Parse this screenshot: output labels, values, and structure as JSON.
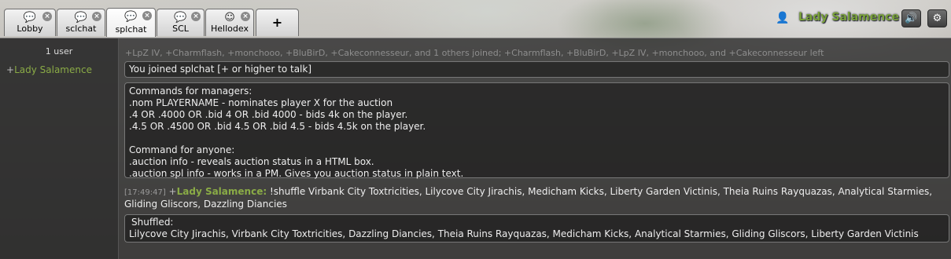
{
  "tabs": [
    {
      "label": "Lobby",
      "icon": "chat-bubble-icon",
      "glyph": "💬",
      "active": false,
      "closable": true
    },
    {
      "label": "sclchat",
      "icon": "chat-bubble-icon",
      "glyph": "💬",
      "active": false,
      "closable": true
    },
    {
      "label": "splchat",
      "icon": "chat-bubble-icon",
      "glyph": "💬",
      "active": true,
      "closable": true
    },
    {
      "label": "SCL",
      "icon": "chat-bubble-icon",
      "glyph": "💬",
      "active": false,
      "closable": true
    },
    {
      "label": "Hellodex",
      "icon": "smiley-icon",
      "glyph": "☺",
      "active": false,
      "closable": true
    }
  ],
  "add_tab": {
    "label": "+"
  },
  "close_glyph": "×",
  "header": {
    "username": "Lady Salamence",
    "user_icon": "person-icon",
    "user_glyph": "👤",
    "sound_icon": "volume-icon",
    "sound_glyph": "🔊",
    "settings_icon": "gear-icon",
    "settings_glyph": "⚙"
  },
  "userlist": {
    "count": "1 user",
    "users": [
      {
        "rank": "+",
        "name": "Lady Salamence"
      }
    ]
  },
  "chat": {
    "join_log": "+LpZ IV, +Charmflash, +monchooo, +BluBirD, +Cakeconnesseur, and 1 others joined; +Charmflash, +BluBirD, +LpZ IV, +monchooo, and +Cakeconnesseur left",
    "joined_notice": "You joined splchat [+ or higher to talk]",
    "commands_box": [
      "Commands for managers:",
      ".nom PLAYERNAME - nominates player X for the auction",
      ".4 OR .4000 OR .bid 4 OR .bid 4000 - bids 4k on the player.",
      ".4.5 OR .4500 OR .bid 4.5 OR .bid 4.5 - bids 4.5k on the player.",
      "",
      "Command for anyone:",
      ".auction info - reveals auction status in a HTML box.",
      ".auction spl info - works in a PM. Gives you auction status in plain text."
    ],
    "message": {
      "timestamp": "[17:49:47]",
      "rank": "+",
      "author": "Lady Salamence:",
      "text": "!shuffle Virbank City Toxtricities, Lilycove City Jirachis, Medicham Kicks, Liberty Garden Victinis, Theia Ruins Rayquazas, Analytical Starmies, Gliding Gliscors, Dazzling Diancies"
    },
    "shuffled_box": {
      "title": "Shuffled:",
      "text": "Lilycove City Jirachis, Virbank City Toxtricities, Dazzling Diancies, Theia Ruins Rayquazas, Medicham Kicks, Analytical Starmies, Gliding Gliscors, Liberty Garden Victinis"
    }
  }
}
